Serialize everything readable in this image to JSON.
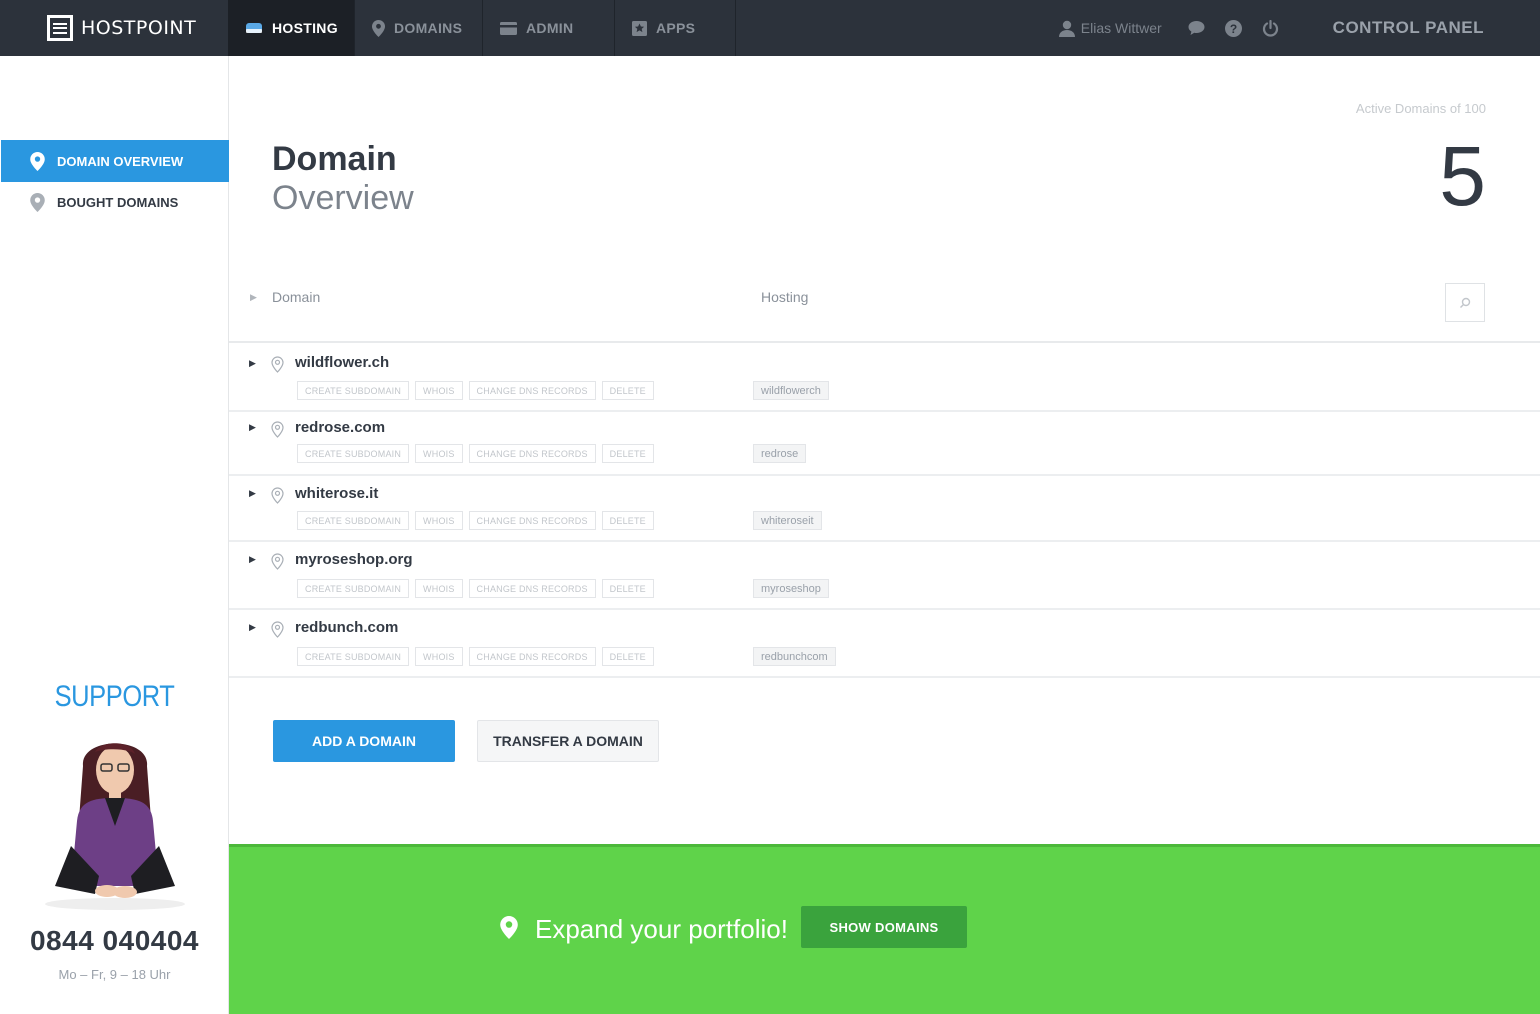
{
  "app": {
    "brand": "HOSTPOINT",
    "section": "CONTROL PANEL"
  },
  "nav": [
    {
      "label": "HOSTING",
      "icon": "hosting-icon",
      "active": true
    },
    {
      "label": "DOMAINS",
      "icon": "pin-icon",
      "active": false
    },
    {
      "label": "ADMIN",
      "icon": "card-icon",
      "active": false
    },
    {
      "label": "APPS",
      "icon": "star-box-icon",
      "active": false
    }
  ],
  "user": {
    "name": "Elias Wittwer"
  },
  "sidebar": {
    "items": [
      {
        "label": "DOMAIN OVERVIEW",
        "active": true
      },
      {
        "label": "BOUGHT DOMAINS",
        "active": false
      }
    ]
  },
  "support": {
    "title": "SUPPORT",
    "phone": "0844 040404",
    "hours": "Mo – Fr, 9 – 18 Uhr"
  },
  "page": {
    "title_bold": "Domain",
    "title_light": "Overview",
    "active_label": "Active Domains of 100",
    "active_count": "5"
  },
  "table": {
    "col_domain": "Domain",
    "col_hosting": "Hosting",
    "actions": [
      "CREATE SUBDOMAIN",
      "WHOIS",
      "CHANGE DNS RECORDS",
      "DELETE"
    ],
    "rows": [
      {
        "domain": "wildflower.ch",
        "hosting": "wildflowerch"
      },
      {
        "domain": "redrose.com",
        "hosting": "redrose"
      },
      {
        "domain": "whiterose.it",
        "hosting": "whiteroseit"
      },
      {
        "domain": "myroseshop.org",
        "hosting": "myroseshop"
      },
      {
        "domain": "redbunch.com",
        "hosting": "redbunchcom"
      }
    ]
  },
  "buttons": {
    "add": "ADD A DOMAIN",
    "transfer": "TRANSFER A DOMAIN"
  },
  "banner": {
    "text": "Expand your portfolio!",
    "button": "SHOW DOMAINS"
  },
  "colors": {
    "accent": "#2a97e0",
    "topbar": "#2c323b",
    "banner": "#5fd34a",
    "banner_button": "#3aa33d"
  }
}
